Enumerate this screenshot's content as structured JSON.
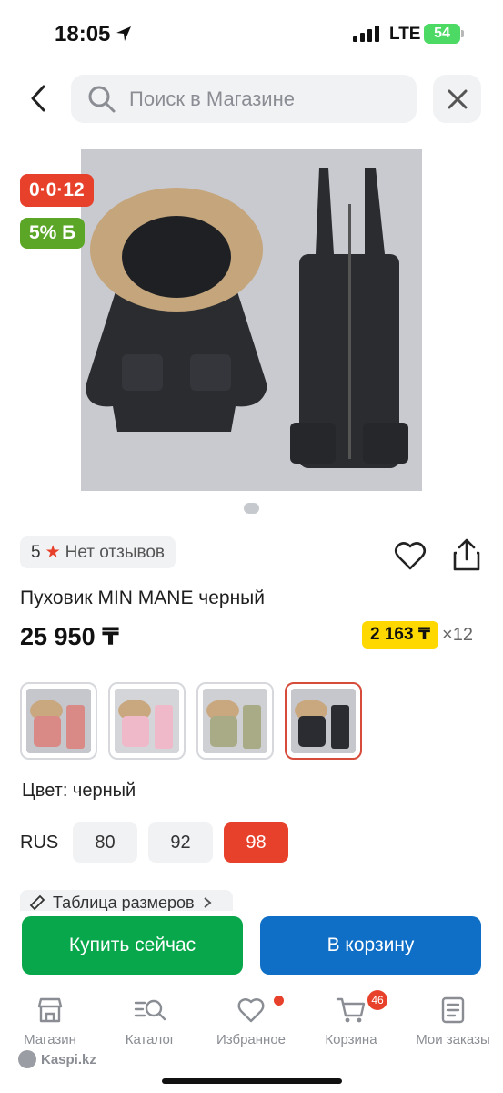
{
  "status_bar": {
    "time": "18:05",
    "network": "LTE",
    "battery": "54"
  },
  "search": {
    "placeholder": "Поиск в Магазине"
  },
  "badges": {
    "timer": "0·0·12",
    "bonus": "5% Б"
  },
  "product": {
    "rating": "5",
    "reviews": "Нет отзывов",
    "title": "Пуховик MIN MANE черный",
    "price": "25 950 ₸",
    "installment_amount": "2 163 ₸",
    "installment_months": "×12"
  },
  "variants": [
    {
      "name": "pink-red",
      "color": "#d98a87"
    },
    {
      "name": "light-pink",
      "color": "#efb9c9"
    },
    {
      "name": "olive",
      "color": "#a9ab86"
    },
    {
      "name": "black",
      "color": "#2a2c31"
    }
  ],
  "color_label": "Цвет: черный",
  "sizes": {
    "system": "RUS",
    "options": [
      "80",
      "92",
      "98"
    ],
    "selected": "98"
  },
  "size_table": "Таблица размеров",
  "actions": {
    "buy_now": "Купить сейчас",
    "add_to_cart": "В корзину"
  },
  "tabbar": {
    "items": [
      {
        "label": "Магазин",
        "icon": "store-icon"
      },
      {
        "label": "Каталог",
        "icon": "catalog-icon"
      },
      {
        "label": "Избранное",
        "icon": "heart-icon"
      },
      {
        "label": "Корзина",
        "icon": "cart-icon",
        "badge": "46"
      },
      {
        "label": "Мои заказы",
        "icon": "orders-icon"
      }
    ]
  },
  "brand": "Kaspi.kz",
  "colors": {
    "red": "#e8412b",
    "green": "#09a74b",
    "blue": "#0f6fc6",
    "yellow": "#ffd800",
    "bonus_green": "#5ba626"
  }
}
